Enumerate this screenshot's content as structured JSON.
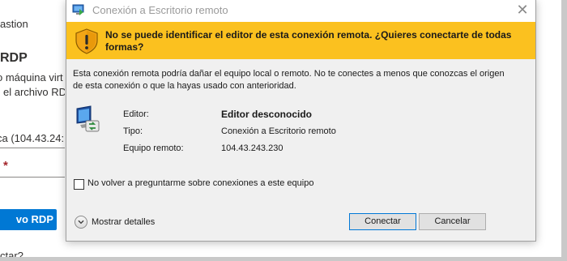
{
  "background_page": {
    "line1": "astion",
    "heading": "RDP",
    "line2": "o máquina virt",
    "line3": "el archivo RD",
    "input_value": "ca (104.43.24:",
    "required_mark": "*",
    "button_label": "vo RDP",
    "bottom_text": "ctar?"
  },
  "dialog": {
    "title": "Conexión a Escritorio remoto",
    "close_glyph": "✕",
    "warning": "No se puede identificar el editor de esta conexión remota. ¿Quieres conectarte de todas formas?",
    "description": "Esta conexión remota podría dañar el equipo local o remoto. No te conectes a menos que conozcas el origen de esta conexión o que la hayas usado con anterioridad.",
    "publisher_label": "Editor:",
    "publisher_value": "Editor desconocido",
    "type_label": "Tipo:",
    "type_value": "Conexión a Escritorio remoto",
    "remote_label": "Equipo remoto:",
    "remote_value": "104.43.243.230",
    "checkbox_label": "No volver a preguntarme sobre conexiones a este equipo",
    "checkbox_checked": false,
    "details_label": "Mostrar detalles",
    "connect_label": "Conectar",
    "cancel_label": "Cancelar"
  },
  "colors": {
    "warning_banner": "#fbc11f",
    "dialog_bg": "#f0f0f0",
    "portal_button": "#0078d4"
  },
  "icons": [
    "remote-desktop-icon",
    "shield-warning-icon",
    "computer-connection-icon",
    "chevron-down-icon",
    "close-icon"
  ]
}
